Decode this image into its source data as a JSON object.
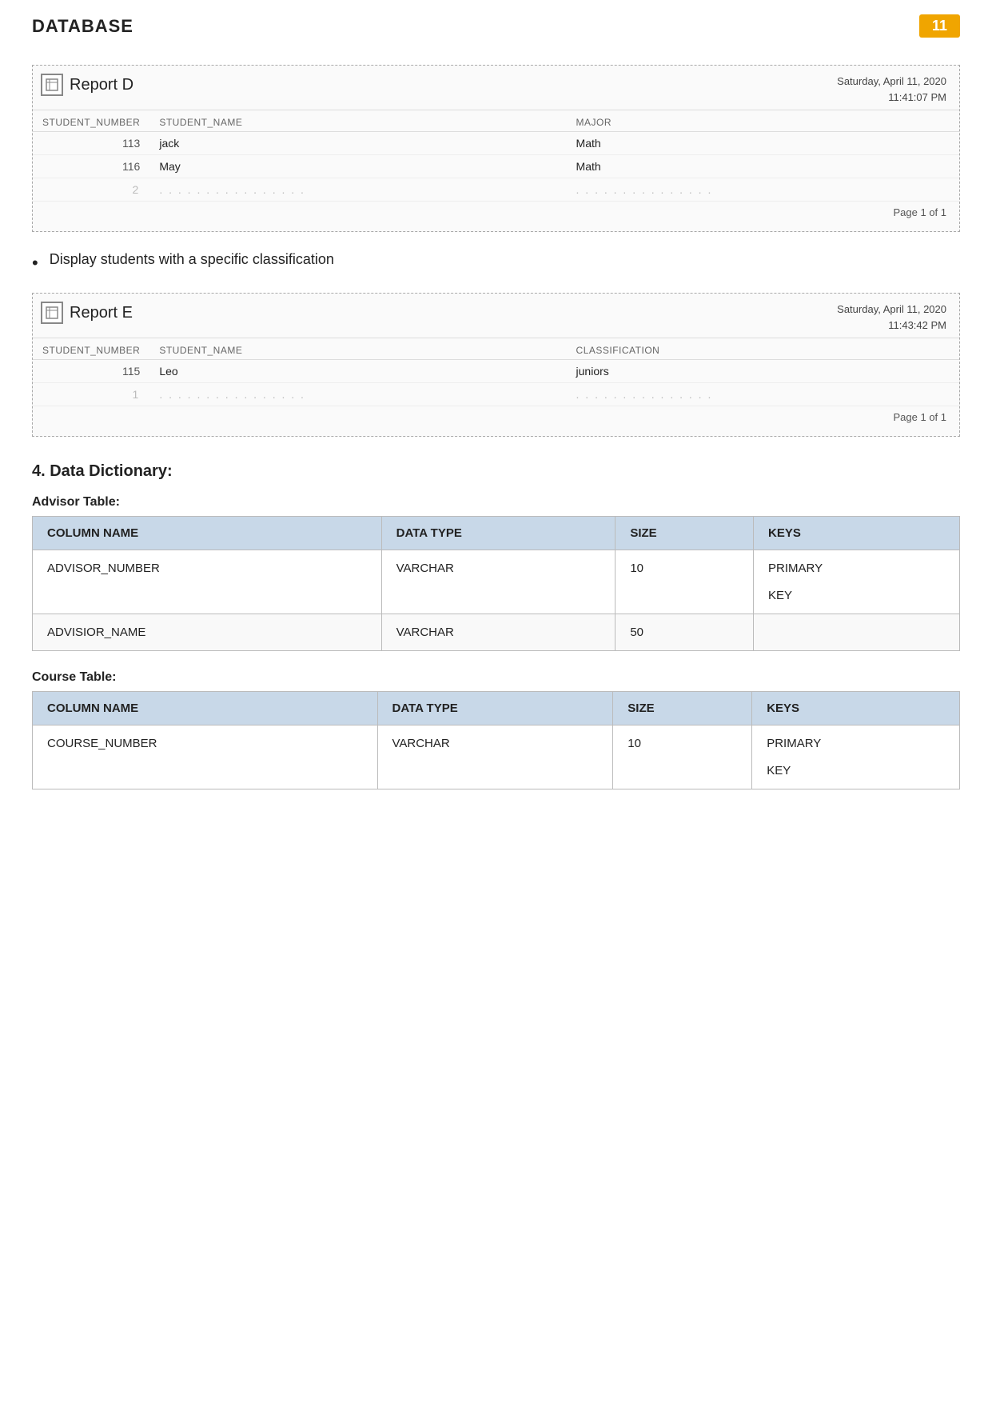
{
  "page": {
    "title": "DATABASE",
    "page_number": "11"
  },
  "report_d": {
    "title": "Report D",
    "date": "Saturday, April 11, 2020",
    "time": "11:41:07 PM",
    "columns": [
      "STUDENT_NUMBER",
      "STUDENT_NAME",
      "MAJOR"
    ],
    "rows": [
      {
        "student_number": "113",
        "student_name": "jack",
        "major": "Math"
      },
      {
        "student_number": "116",
        "student_name": "May",
        "major": "Math"
      }
    ],
    "count_row": "2",
    "page_info": "Page 1 of 1"
  },
  "bullet": {
    "text": "Display students with a specific classification"
  },
  "report_e": {
    "title": "Report E",
    "date": "Saturday, April 11, 2020",
    "time": "11:43:42 PM",
    "columns": [
      "STUDENT_NUMBER",
      "STUDENT_NAME",
      "CLASSIFICATION"
    ],
    "rows": [
      {
        "student_number": "115",
        "student_name": "Leo",
        "classification": "juniors"
      }
    ],
    "count_row": "1",
    "page_info": "Page 1 of 1"
  },
  "section_heading": "4.  Data Dictionary:",
  "advisor_table": {
    "heading": "Advisor Table:",
    "columns": [
      "COLUMN NAME",
      "DATA TYPE",
      "SIZE",
      "KEYS"
    ],
    "rows": [
      {
        "col_name": "ADVISOR_NUMBER",
        "data_type": "VARCHAR",
        "size": "10",
        "keys": "PRIMARY\n\nKEY"
      },
      {
        "col_name": "ADVISIOR_NAME",
        "data_type": "VARCHAR",
        "size": "50",
        "keys": ""
      }
    ]
  },
  "course_table": {
    "heading": "Course Table:",
    "columns": [
      "COLUMN NAME",
      "DATA TYPE",
      "SIZE",
      "KEYS"
    ],
    "rows": [
      {
        "col_name": "COURSE_NUMBER",
        "data_type": "VARCHAR",
        "size": "10",
        "keys": "PRIMARY\n\nKEY"
      }
    ]
  }
}
